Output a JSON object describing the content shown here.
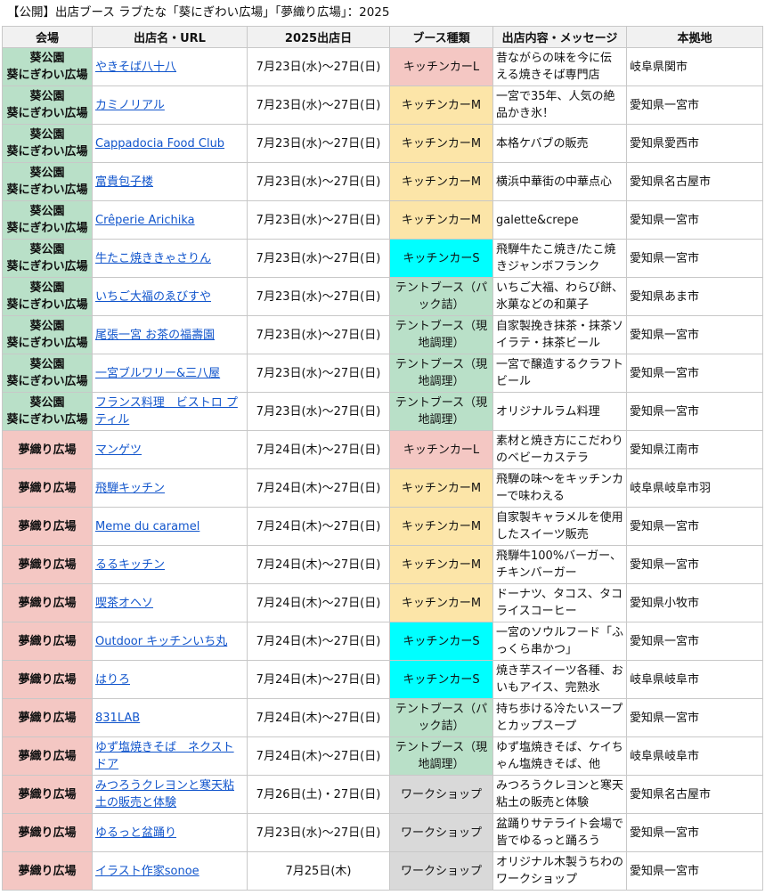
{
  "title": "【公開】出店ブース ラブたな「葵にぎわい広場」「夢織り広場」：2025",
  "headers": {
    "venue": "会場",
    "shop": "出店名・URL",
    "date": "2025出店日",
    "booth": "ブース種類",
    "msg": "出店内容・メッセージ",
    "base": "本拠地"
  },
  "rows": [
    {
      "venue_l1": "葵公園",
      "venue_l2": "葵にぎわい広場",
      "shop": "やきそば八十八",
      "date": "7月23日(水)〜27日(日)",
      "booth": "キッチンカーL",
      "msg": "昔ながらの味を今に伝える焼きそば専門店",
      "base": "岐阜県関市"
    },
    {
      "venue_l1": "葵公園",
      "venue_l2": "葵にぎわい広場",
      "shop": "カミノリアル",
      "date": "7月23日(水)〜27日(日)",
      "booth": "キッチンカーM",
      "msg": "一宮で35年、人気の絶品かき氷！",
      "base": "愛知県一宮市"
    },
    {
      "venue_l1": "葵公園",
      "venue_l2": "葵にぎわい広場",
      "shop": "Cappadocia Food Club",
      "date": "7月23日(水)〜27日(日)",
      "booth": "キッチンカーM",
      "msg": "本格ケバブの販売",
      "base": "愛知県愛西市"
    },
    {
      "venue_l1": "葵公園",
      "venue_l2": "葵にぎわい広場",
      "shop": "富貴包子楼",
      "date": "7月23日(水)〜27日(日)",
      "booth": "キッチンカーM",
      "msg": "横浜中華街の中華点心",
      "base": "愛知県名古屋市"
    },
    {
      "venue_l1": "葵公園",
      "venue_l2": "葵にぎわい広場",
      "shop": "Crêperie Arichika",
      "date": "7月23日(水)〜27日(日)",
      "booth": "キッチンカーM",
      "msg": "galette&crepe",
      "base": "愛知県一宮市"
    },
    {
      "venue_l1": "葵公園",
      "venue_l2": "葵にぎわい広場",
      "shop": "牛たこ焼ききゃさりん",
      "date": "7月23日(水)〜27日(日)",
      "booth": "キッチンカーS",
      "msg": "飛騨牛たこ焼き/たこ焼きジャンボフランク",
      "base": "愛知県一宮市"
    },
    {
      "venue_l1": "葵公園",
      "venue_l2": "葵にぎわい広場",
      "shop": "いちご大福のゑびすや",
      "date": "7月23日(水)〜27日(日)",
      "booth": "テントブース（パック詰）",
      "msg": "いちご大福、わらび餅、氷菓などの和菓子",
      "base": "愛知県あま市"
    },
    {
      "venue_l1": "葵公園",
      "venue_l2": "葵にぎわい広場",
      "shop": "尾張一宮 お茶の福壽園",
      "date": "7月23日(水)〜27日(日)",
      "booth": "テントブース（現地調理）",
      "msg": "自家製挽き抹茶・抹茶ソイラテ・抹茶ビール",
      "base": "愛知県一宮市"
    },
    {
      "venue_l1": "葵公園",
      "venue_l2": "葵にぎわい広場",
      "shop": "一宮ブルワリー&三八屋",
      "date": "7月23日(水)〜27日(日)",
      "booth": "テントブース（現地調理）",
      "msg": "一宮で醸造するクラフトビール",
      "base": "愛知県一宮市"
    },
    {
      "venue_l1": "葵公園",
      "venue_l2": "葵にぎわい広場",
      "shop": "フランス料理　ビストロ プティル",
      "date": "7月23日(水)〜27日(日)",
      "booth": "テントブース（現地調理）",
      "msg": "オリジナルラム料理",
      "base": "愛知県一宮市"
    },
    {
      "venue_l1": "夢織り広場",
      "venue_l2": "",
      "shop": "マンゲツ",
      "date": "7月24日(木)〜27日(日)",
      "booth": "キッチンカーL",
      "msg": "素材と焼き方にこだわりのベビーカステラ",
      "base": "愛知県江南市"
    },
    {
      "venue_l1": "夢織り広場",
      "venue_l2": "",
      "shop": "飛騨キッチン",
      "date": "7月24日(木)〜27日(日)",
      "booth": "キッチンカーM",
      "msg": "飛騨の味〜をキッチンカーで味わえる",
      "base": "岐阜県岐阜市羽"
    },
    {
      "venue_l1": "夢織り広場",
      "venue_l2": "",
      "shop": "Meme du caramel",
      "date": "7月24日(木)〜27日(日)",
      "booth": "キッチンカーM",
      "msg": "自家製キャラメルを使用したスイーツ販売",
      "base": "愛知県一宮市"
    },
    {
      "venue_l1": "夢織り広場",
      "venue_l2": "",
      "shop": "るるキッチン",
      "date": "7月24日(木)〜27日(日)",
      "booth": "キッチンカーM",
      "msg": "飛騨牛100%バーガー、チキンバーガー",
      "base": "愛知県一宮市"
    },
    {
      "venue_l1": "夢織り広場",
      "venue_l2": "",
      "shop": "喫茶オヘソ",
      "date": "7月24日(木)〜27日(日)",
      "booth": "キッチンカーM",
      "msg": "ドーナツ、タコス、タコライスコーヒー",
      "base": "愛知県小牧市"
    },
    {
      "venue_l1": "夢織り広場",
      "venue_l2": "",
      "shop": "Outdoor キッチンいち丸",
      "date": "7月24日(木)〜27日(日)",
      "booth": "キッチンカーS",
      "msg": "一宮のソウルフード「ふっくら串かつ」",
      "base": "愛知県一宮市"
    },
    {
      "venue_l1": "夢織り広場",
      "venue_l2": "",
      "shop": "はりろ",
      "date": "7月24日(木)〜27日(日)",
      "booth": "キッチンカーS",
      "msg": "焼き芋スイーツ各種、おいもアイス、完熟氷",
      "base": "岐阜県岐阜市"
    },
    {
      "venue_l1": "夢織り広場",
      "venue_l2": "",
      "shop": "831LAB",
      "date": "7月24日(木)〜27日(日)",
      "booth": "テントブース（パック詰）",
      "msg": "持ち歩ける冷たいスープとカップスープ",
      "base": "愛知県一宮市"
    },
    {
      "venue_l1": "夢織り広場",
      "venue_l2": "",
      "shop": "ゆず塩焼きそば　ネクストドア",
      "date": "7月24日(木)〜27日(日)",
      "booth": "テントブース（現地調理）",
      "msg": "ゆず塩焼きそば、ケイちゃん塩焼きそば、他",
      "base": "岐阜県岐阜市"
    },
    {
      "venue_l1": "夢織り広場",
      "venue_l2": "",
      "shop": "みつろうクレヨンと寒天粘土の販売と体験",
      "date": "7月26日(土)・27日(日)",
      "booth": "ワークショップ",
      "msg": "みつろうクレヨンと寒天粘土の販売と体験",
      "base": "愛知県名古屋市"
    },
    {
      "venue_l1": "夢織り広場",
      "venue_l2": "",
      "shop": "ゆるっと盆踊り",
      "date": "7月23日(水)〜27日(日)",
      "booth": "ワークショップ",
      "msg": "盆踊りサテライト会場で皆でゆるっと踊ろう",
      "base": "愛知県一宮市"
    },
    {
      "venue_l1": "夢織り広場",
      "venue_l2": "",
      "shop": "イラスト作家sonoe",
      "date": "7月25日(木)",
      "booth": "ワークショップ",
      "msg": "オリジナル木製うちわのワークショップ",
      "base": "愛知県一宮市"
    }
  ]
}
